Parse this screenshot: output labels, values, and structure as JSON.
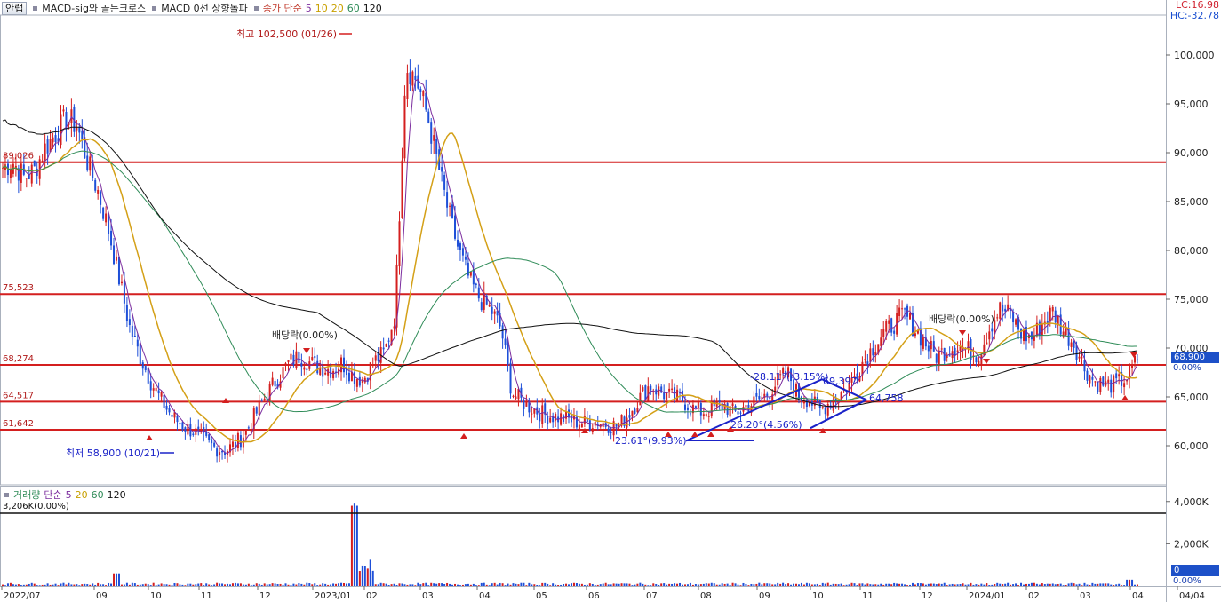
{
  "toolbar": {
    "tab_button": "안랩",
    "indicator_1": "MACD-sig와 골든크로스",
    "indicator_2": "MACD 0선 상향돌파",
    "ma_title": "종가 단순",
    "ma_5": "5",
    "ma_10": "10",
    "ma_20": "20",
    "ma_60": "60",
    "ma_120": "120"
  },
  "readout": {
    "lc": "LC:16.98",
    "hc": "HC:-32.78"
  },
  "volume_legend": {
    "title": "거래량",
    "ma_title": "단순",
    "ma_5": "5",
    "ma_20": "20",
    "ma_60": "60",
    "ma_120": "120",
    "overlay_text": "3,206K",
    "overlay_pct": "(0.00%)"
  },
  "current": {
    "price_tag": "68,900",
    "pct_tag": "0.00%",
    "vol_tag": "0",
    "vol_pct": "0.00%"
  },
  "colors": {
    "up": "#d41f1f",
    "down": "#1e4fd8",
    "ma5": "#7b2c9e",
    "ma20": "#d4a017",
    "ma60": "#2e8b57",
    "ma120": "#111111",
    "hline": "#d41f1f",
    "trend": "#1a22c8"
  },
  "chart_data": [
    {
      "type": "candlestick",
      "title": "",
      "x_tick_labels": [
        "2022/07",
        "09",
        "10",
        "11",
        "12",
        "2023/01",
        "02",
        "03",
        "04",
        "05",
        "06",
        "07",
        "08",
        "09",
        "10",
        "11",
        "12",
        "2024/01",
        "02",
        "03",
        "04",
        "04/04"
      ],
      "y_ticks": [
        60000,
        65000,
        70000,
        75000,
        80000,
        85000,
        90000,
        95000,
        100000
      ],
      "ylim": [
        56000,
        104000
      ],
      "last_price": 68900,
      "horizontal_levels": [
        {
          "value": 89026,
          "label": "89,026"
        },
        {
          "value": 75523,
          "label": "75,523"
        },
        {
          "value": 68274,
          "label": "68,274"
        },
        {
          "value": 64517,
          "label": "64,517"
        },
        {
          "value": 61642,
          "label": "61,642"
        }
      ],
      "annotations": {
        "high": "최고 102,500 (01/26)",
        "low": "최저 58,900 (10/21)",
        "div1": "배당락(0.00%)",
        "div2": "배당락(0.00%)",
        "angle_1": "23.61°(9.93%)",
        "angle_2": "-28.11°(-3.15%)",
        "angle_3": "26.20°(4.56%)",
        "tri_1": "69,397",
        "tri_2": "64,758"
      },
      "weekly_close": [
        88500,
        89000,
        87500,
        88200,
        90500,
        92000,
        93500,
        92800,
        89000,
        86000,
        82000,
        77000,
        72000,
        69000,
        66500,
        64500,
        63000,
        62000,
        61500,
        60500,
        59800,
        59500,
        60200,
        61500,
        63500,
        65500,
        67000,
        68500,
        69200,
        68500,
        68000,
        67800,
        68500,
        67200,
        66800,
        68600,
        69500,
        73500,
        99000,
        97500,
        94000,
        89000,
        84000,
        80000,
        77000,
        75000,
        74000,
        72000,
        65500,
        64500,
        63800,
        63200,
        63000,
        62800,
        62500,
        62300,
        62500,
        62200,
        62000,
        63200,
        64800,
        66200,
        65500,
        65000,
        64800,
        63800,
        63500,
        63800,
        64200,
        63300,
        64000,
        64500,
        65200,
        66500,
        67500,
        65200,
        64800,
        63600,
        64500,
        65400,
        66500,
        68500,
        70000,
        71500,
        72500,
        73500,
        72000,
        70500,
        69200,
        69800,
        70300,
        69800,
        69300,
        72000,
        74000,
        73500,
        71500,
        71000,
        72500,
        73800,
        71800,
        70500,
        68000,
        66500,
        66200,
        66300,
        67000,
        68900
      ],
      "ma_120_note": "long-term moving average"
    },
    {
      "type": "bar",
      "title": "",
      "y_ticks": [
        "2,000K",
        "4,000K"
      ],
      "ylim": [
        0,
        4200
      ],
      "spike_values_k": [
        3800,
        3900
      ],
      "last_volume": 0
    }
  ]
}
